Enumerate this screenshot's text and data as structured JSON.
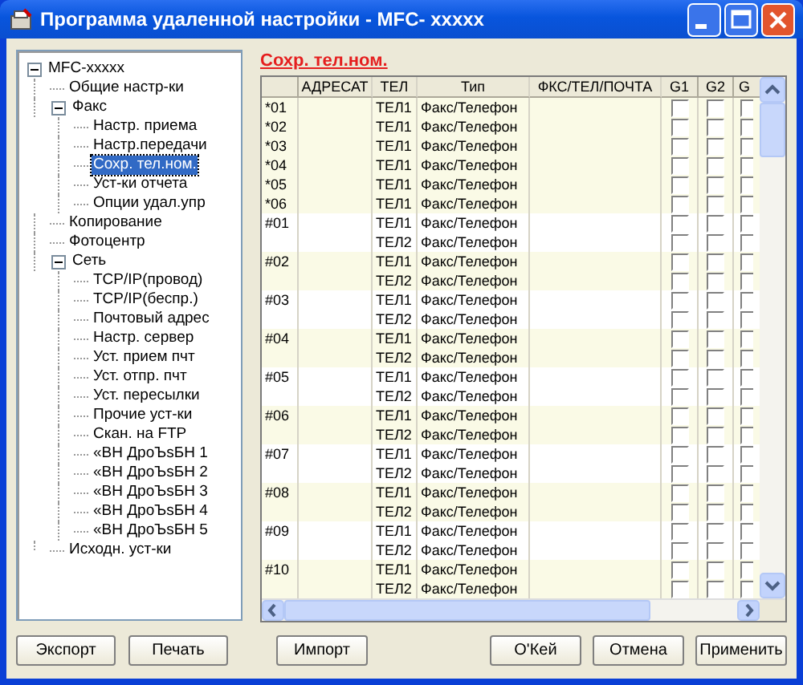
{
  "window": {
    "title": "Программа удаленной настройки - MFC- xxxxx"
  },
  "tree": [
    {
      "label": "MFC-xxxxx",
      "expanded": true,
      "selected": false,
      "children": [
        {
          "label": "Общие настр-ки",
          "selected": false
        },
        {
          "label": "Факс",
          "expanded": true,
          "selected": false,
          "children": [
            {
              "label": "Настр. приема",
              "selected": false
            },
            {
              "label": "Настр.передачи",
              "selected": false
            },
            {
              "label": "Сохр. тел.ном.",
              "selected": true
            },
            {
              "label": "Уст-ки отчета",
              "selected": false
            },
            {
              "label": "Опции удал.упр",
              "selected": false
            }
          ]
        },
        {
          "label": "Копирование",
          "selected": false
        },
        {
          "label": "Фотоцентр",
          "selected": false
        },
        {
          "label": "Сеть",
          "expanded": true,
          "selected": false,
          "children": [
            {
              "label": "TCP/IP(провод)",
              "selected": false
            },
            {
              "label": "TCP/IP(беспр.)",
              "selected": false
            },
            {
              "label": "Почтовый адрес",
              "selected": false
            },
            {
              "label": "Настр. сервер",
              "selected": false
            },
            {
              "label": "Уст. прием пчт",
              "selected": false
            },
            {
              "label": "Уст. отпр. пчт",
              "selected": false
            },
            {
              "label": "Уст. пересылки",
              "selected": false
            },
            {
              "label": "Прочие уст-ки",
              "selected": false
            },
            {
              "label": "Скан. на FTP",
              "selected": false
            },
            {
              "label": "«ВН ДроЪsБН 1",
              "selected": false
            },
            {
              "label": "«ВН ДроЪsБН 2",
              "selected": false
            },
            {
              "label": "«ВН ДроЪsБН 3",
              "selected": false
            },
            {
              "label": "«ВН ДроЪsБН 4",
              "selected": false
            },
            {
              "label": "«ВН ДроЪsБН 5",
              "selected": false
            }
          ]
        },
        {
          "label": "Исходн. уст-ки",
          "selected": false
        }
      ]
    }
  ],
  "table": {
    "title": "Сохр. тел.ном.",
    "columns": [
      "АДРЕСАТ",
      "ТЕЛ",
      "Тип",
      "ФКС/ТЕЛ/ПОЧТА",
      "G1",
      "G2",
      "G"
    ],
    "rows": [
      {
        "label": "*01",
        "shaded": true,
        "lines": [
          {
            "tel": "ТЕЛ1",
            "type": "Факс/Телефон",
            "checks": [
              false,
              false,
              false
            ]
          }
        ]
      },
      {
        "label": "*02",
        "shaded": true,
        "lines": [
          {
            "tel": "ТЕЛ1",
            "type": "Факс/Телефон",
            "checks": [
              false,
              false,
              false
            ]
          }
        ]
      },
      {
        "label": "*03",
        "shaded": true,
        "lines": [
          {
            "tel": "ТЕЛ1",
            "type": "Факс/Телефон",
            "checks": [
              false,
              false,
              false
            ]
          }
        ]
      },
      {
        "label": "*04",
        "shaded": true,
        "lines": [
          {
            "tel": "ТЕЛ1",
            "type": "Факс/Телефон",
            "checks": [
              false,
              false,
              false
            ]
          }
        ]
      },
      {
        "label": "*05",
        "shaded": true,
        "lines": [
          {
            "tel": "ТЕЛ1",
            "type": "Факс/Телефон",
            "checks": [
              false,
              false,
              false
            ]
          }
        ]
      },
      {
        "label": "*06",
        "shaded": true,
        "lines": [
          {
            "tel": "ТЕЛ1",
            "type": "Факс/Телефон",
            "checks": [
              false,
              false,
              false
            ]
          }
        ]
      },
      {
        "label": "#01",
        "shaded": false,
        "lines": [
          {
            "tel": "ТЕЛ1",
            "type": "Факс/Телефон",
            "checks": [
              false,
              false,
              false
            ]
          },
          {
            "tel": "ТЕЛ2",
            "type": "Факс/Телефон",
            "checks": [
              false,
              false,
              false
            ]
          }
        ]
      },
      {
        "label": "#02",
        "shaded": true,
        "lines": [
          {
            "tel": "ТЕЛ1",
            "type": "Факс/Телефон",
            "checks": [
              false,
              false,
              false
            ]
          },
          {
            "tel": "ТЕЛ2",
            "type": "Факс/Телефон",
            "checks": [
              false,
              false,
              false
            ]
          }
        ]
      },
      {
        "label": "#03",
        "shaded": false,
        "lines": [
          {
            "tel": "ТЕЛ1",
            "type": "Факс/Телефон",
            "checks": [
              false,
              false,
              false
            ]
          },
          {
            "tel": "ТЕЛ2",
            "type": "Факс/Телефон",
            "checks": [
              false,
              false,
              false
            ]
          }
        ]
      },
      {
        "label": "#04",
        "shaded": true,
        "lines": [
          {
            "tel": "ТЕЛ1",
            "type": "Факс/Телефон",
            "checks": [
              false,
              false,
              false
            ]
          },
          {
            "tel": "ТЕЛ2",
            "type": "Факс/Телефон",
            "checks": [
              false,
              false,
              false
            ]
          }
        ]
      },
      {
        "label": "#05",
        "shaded": false,
        "lines": [
          {
            "tel": "ТЕЛ1",
            "type": "Факс/Телефон",
            "checks": [
              false,
              false,
              false
            ]
          },
          {
            "tel": "ТЕЛ2",
            "type": "Факс/Телефон",
            "checks": [
              false,
              false,
              false
            ]
          }
        ]
      },
      {
        "label": "#06",
        "shaded": true,
        "lines": [
          {
            "tel": "ТЕЛ1",
            "type": "Факс/Телефон",
            "checks": [
              false,
              false,
              false
            ]
          },
          {
            "tel": "ТЕЛ2",
            "type": "Факс/Телефон",
            "checks": [
              false,
              false,
              false
            ]
          }
        ]
      },
      {
        "label": "#07",
        "shaded": false,
        "lines": [
          {
            "tel": "ТЕЛ1",
            "type": "Факс/Телефон",
            "checks": [
              false,
              false,
              false
            ]
          },
          {
            "tel": "ТЕЛ2",
            "type": "Факс/Телефон",
            "checks": [
              false,
              false,
              false
            ]
          }
        ]
      },
      {
        "label": "#08",
        "shaded": true,
        "lines": [
          {
            "tel": "ТЕЛ1",
            "type": "Факс/Телефон",
            "checks": [
              false,
              false,
              false
            ]
          },
          {
            "tel": "ТЕЛ2",
            "type": "Факс/Телефон",
            "checks": [
              false,
              false,
              false
            ]
          }
        ]
      },
      {
        "label": "#09",
        "shaded": false,
        "lines": [
          {
            "tel": "ТЕЛ1",
            "type": "Факс/Телефон",
            "checks": [
              false,
              false,
              false
            ]
          },
          {
            "tel": "ТЕЛ2",
            "type": "Факс/Телефон",
            "checks": [
              false,
              false,
              false
            ]
          }
        ]
      },
      {
        "label": "#10",
        "shaded": true,
        "lines": [
          {
            "tel": "ТЕЛ1",
            "type": "Факс/Телефон",
            "checks": [
              false,
              false,
              false
            ]
          },
          {
            "tel": "ТЕЛ2",
            "type": "Факс/Телефон",
            "checks": [
              false,
              false,
              false
            ]
          }
        ]
      }
    ]
  },
  "footer": {
    "left": [
      "Экспорт",
      "Печать"
    ],
    "middle": [
      "Импорт"
    ],
    "right": [
      "О'Кей",
      "Отмена",
      "Применить"
    ]
  }
}
